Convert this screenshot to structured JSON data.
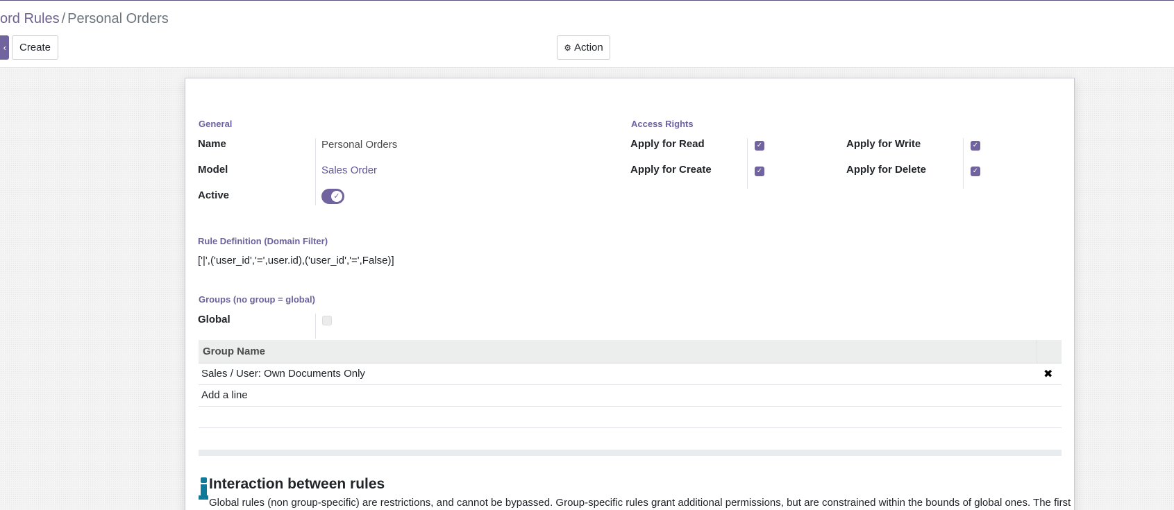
{
  "breadcrumb": {
    "parent": "ord Rules",
    "separator": "/",
    "current": "Personal Orders"
  },
  "toolbar": {
    "save_stub": "‹",
    "create_label": "Create",
    "action_icon": "gear-icon",
    "action_label": "Action"
  },
  "form": {
    "general": {
      "title": "General",
      "name_label": "Name",
      "name_value": "Personal Orders",
      "model_label": "Model",
      "model_value": "Sales Order",
      "active_label": "Active",
      "active": true
    },
    "access_rights": {
      "title": "Access Rights",
      "read_label": "Apply for Read",
      "read": true,
      "write_label": "Apply for Write",
      "write": true,
      "create_label": "Apply for Create",
      "create": true,
      "delete_label": "Apply for Delete",
      "delete": true
    },
    "domain": {
      "title": "Rule Definition (Domain Filter)",
      "value": "['|',('user_id','=',user.id),('user_id','=',False)]"
    },
    "groups": {
      "title": "Groups (no group = global)",
      "global_label": "Global",
      "global": false,
      "column_header": "Group Name",
      "rows": [
        "Sales / User: Own Documents Only"
      ],
      "add_line": "Add a line"
    },
    "info": {
      "title": "Interaction between rules",
      "text": "Global rules (non group-specific) are restrictions, and cannot be bypassed. Group-specific rules grant additional permissions, but are constrained within the bounds of global ones. The first"
    }
  },
  "colors": {
    "accent": "#71639e",
    "link": "#5f5496",
    "info": "#0f7a9a"
  }
}
